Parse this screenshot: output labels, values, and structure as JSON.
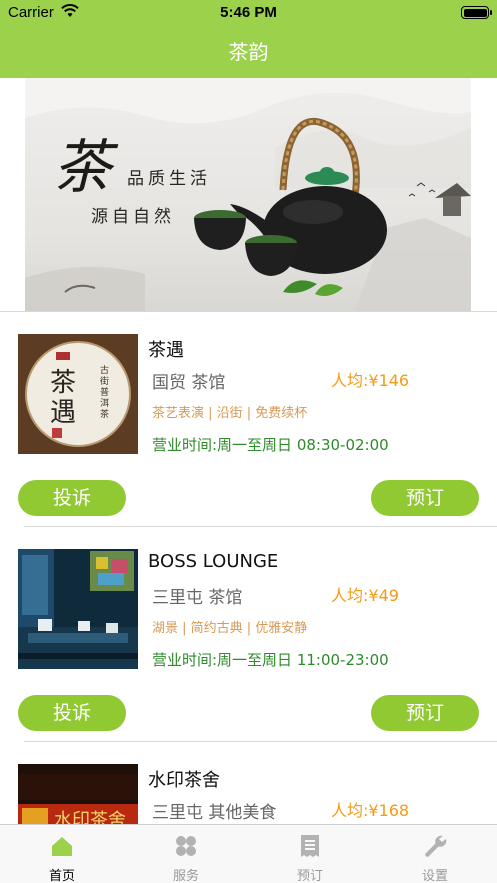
{
  "status_bar": {
    "carrier": "Carrier",
    "time": "5:46 PM"
  },
  "header": {
    "title": "茶韵"
  },
  "banner": {
    "logo_text": "茶",
    "line1": "品质生活",
    "line2": "源自自然"
  },
  "shops": [
    {
      "name": "茶遇",
      "area": "国贸  茶馆",
      "price": "人均:¥146",
      "tags": "茶艺表演 | 沿街 | 免费续杯",
      "hours": "营业时间:周一至周日 08:30-02:00",
      "complain_label": "投诉",
      "book_label": "预订",
      "thumb_text": "茶遇",
      "thumb_side_text": "古街普洱茶"
    },
    {
      "name": "BOSS LOUNGE",
      "area": "三里屯  茶馆",
      "price": "人均:¥49",
      "tags": "湖景 | 简约古典 | 优雅安静",
      "hours": "营业时间:周一至周日 11:00-23:00",
      "complain_label": "投诉",
      "book_label": "预订"
    },
    {
      "name": "水印茶舍",
      "area": "三里屯  其他美食",
      "price": "人均:¥168",
      "thumb_text": "水印茶舍"
    }
  ],
  "tabbar": {
    "items": [
      {
        "label": "首页",
        "icon": "home-icon",
        "active": true
      },
      {
        "label": "服务",
        "icon": "grid-icon",
        "active": false
      },
      {
        "label": "预订",
        "icon": "receipt-icon",
        "active": false
      },
      {
        "label": "设置",
        "icon": "wrench-icon",
        "active": false
      }
    ]
  },
  "colors": {
    "brand": "#9cd14b",
    "button": "#91c933",
    "price": "#f59a14",
    "tags": "#d79a56",
    "hours": "#2e8a2a"
  }
}
